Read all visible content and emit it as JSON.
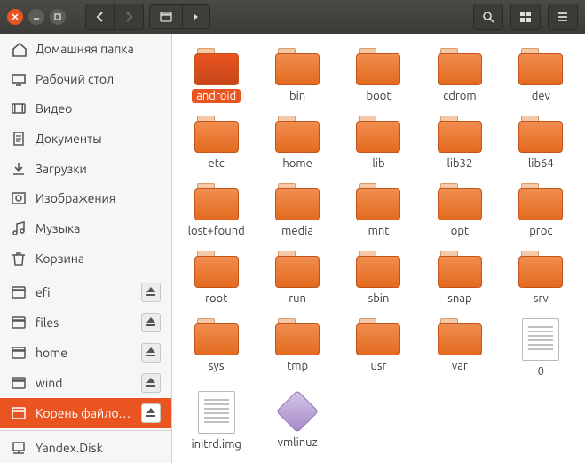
{
  "window": {
    "close_icon": "close",
    "min_icon": "minimize",
    "max_icon": "maximize"
  },
  "toolbar": {
    "back": "back",
    "forward": "forward",
    "search": "search",
    "view": "view-grid",
    "menu": "menu"
  },
  "pathbar": {
    "segments": [
      {
        "icon": "disk",
        "label": ""
      },
      {
        "icon": "chevron-right",
        "label": ""
      }
    ]
  },
  "sidebar": {
    "places": [
      {
        "icon": "home",
        "label": "Домашняя папка"
      },
      {
        "icon": "desktop",
        "label": "Рабочий стол"
      },
      {
        "icon": "video",
        "label": "Видео"
      },
      {
        "icon": "documents",
        "label": "Документы"
      },
      {
        "icon": "downloads",
        "label": "Загрузки"
      },
      {
        "icon": "pictures",
        "label": "Изображения"
      },
      {
        "icon": "music",
        "label": "Музыка"
      },
      {
        "icon": "trash",
        "label": "Корзина"
      }
    ],
    "devices": [
      {
        "icon": "disk",
        "label": "efi",
        "eject": true,
        "selected": false
      },
      {
        "icon": "disk",
        "label": "files",
        "eject": true,
        "selected": false
      },
      {
        "icon": "disk",
        "label": "home",
        "eject": true,
        "selected": false
      },
      {
        "icon": "disk",
        "label": "wind",
        "eject": true,
        "selected": false
      },
      {
        "icon": "disk",
        "label": "Корень файло…",
        "eject": true,
        "selected": true
      }
    ],
    "network": [
      {
        "icon": "network",
        "label": "Yandex.Disk"
      }
    ]
  },
  "content": {
    "items": [
      {
        "type": "folder",
        "name": "android",
        "selected": true
      },
      {
        "type": "folder",
        "name": "bin"
      },
      {
        "type": "folder",
        "name": "boot"
      },
      {
        "type": "folder",
        "name": "cdrom"
      },
      {
        "type": "folder",
        "name": "dev"
      },
      {
        "type": "folder",
        "name": "etc"
      },
      {
        "type": "folder",
        "name": "home"
      },
      {
        "type": "folder",
        "name": "lib"
      },
      {
        "type": "folder",
        "name": "lib32"
      },
      {
        "type": "folder",
        "name": "lib64"
      },
      {
        "type": "folder",
        "name": "lost+found"
      },
      {
        "type": "folder",
        "name": "media"
      },
      {
        "type": "folder",
        "name": "mnt"
      },
      {
        "type": "folder",
        "name": "opt"
      },
      {
        "type": "folder",
        "name": "proc"
      },
      {
        "type": "folder",
        "name": "root"
      },
      {
        "type": "folder",
        "name": "run"
      },
      {
        "type": "folder",
        "name": "sbin"
      },
      {
        "type": "folder",
        "name": "snap"
      },
      {
        "type": "folder",
        "name": "srv"
      },
      {
        "type": "folder",
        "name": "sys"
      },
      {
        "type": "folder",
        "name": "tmp"
      },
      {
        "type": "folder",
        "name": "usr"
      },
      {
        "type": "folder",
        "name": "var"
      },
      {
        "type": "file",
        "name": "0"
      },
      {
        "type": "file",
        "name": "initrd.img"
      },
      {
        "type": "exec",
        "name": "vmlinuz"
      }
    ]
  }
}
